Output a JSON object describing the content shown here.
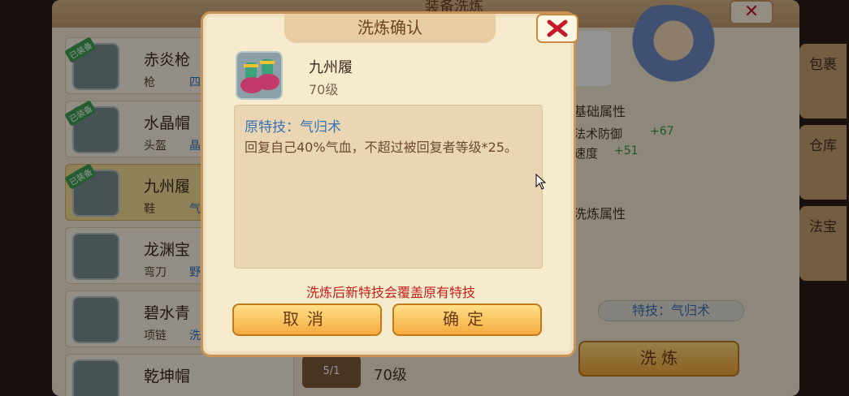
{
  "background": {
    "panel_title": "装备洗炼",
    "items": [
      {
        "name": "赤炎枪",
        "type": "枪",
        "grade": "四",
        "equipped": true,
        "badge": "已装备"
      },
      {
        "name": "水晶帽",
        "type": "头盔",
        "grade": "晶",
        "equipped": true,
        "badge": "已装备"
      },
      {
        "name": "九州履",
        "type": "鞋",
        "grade": "气",
        "equipped": true,
        "badge": "已装备"
      },
      {
        "name": "龙渊宝",
        "type": "弯刀",
        "grade": "野",
        "equipped": false,
        "badge": ""
      },
      {
        "name": "碧水青",
        "type": "项链",
        "grade": "洗",
        "equipped": false,
        "badge": ""
      },
      {
        "name": "乾坤帽",
        "type": "",
        "grade": "",
        "equipped": false,
        "badge": ""
      }
    ],
    "right_panel": {
      "base_attr_label": "基础属性",
      "attrs": [
        {
          "label": "法术防御",
          "value": "+67"
        },
        {
          "label": "速度",
          "value": "+51"
        }
      ],
      "refine_attr_label": "洗炼属性",
      "skill_pill": "特技：气归术",
      "refine_button": "洗 炼"
    },
    "side_tabs": [
      "包裹",
      "仓库",
      "法宝"
    ],
    "bottom_pack": "5/1",
    "bottom_level": "70级"
  },
  "modal": {
    "title": "洗炼确认",
    "equip_name": "九州履",
    "equip_level": "70级",
    "skill_title": "原特技：气归术",
    "skill_desc": "回复自己40%气血，不超过被回复者等级*25。",
    "warning": "洗炼后新特技会覆盖原有特技",
    "cancel_label": "取消",
    "confirm_label": "确定"
  },
  "colors": {
    "accent_blue": "#3873b8",
    "warning_red": "#c4201c",
    "button_gold": "#f4ab3e",
    "close_red": "#c6192b"
  }
}
